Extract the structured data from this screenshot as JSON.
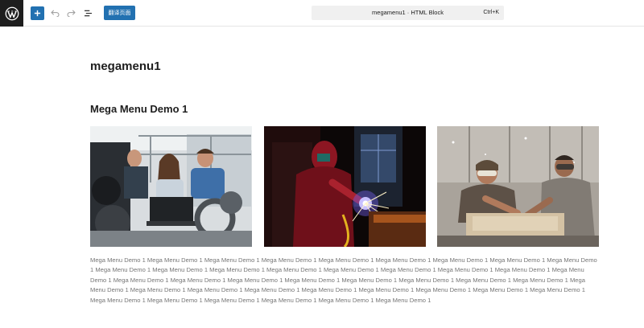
{
  "toolbar": {
    "logo_icon": "wordpress-logo-icon",
    "icons": [
      "plus-icon",
      "undo-icon",
      "redo-icon",
      "list-view-icon"
    ],
    "translate_label": "翻译页面",
    "document_title": "megamenu1 · HTML Block",
    "shortcut": "Ctrl+K",
    "accent_color": "#2271b1"
  },
  "content": {
    "page_title": "megamenu1",
    "heading": "Mega Menu Demo 1",
    "images": [
      {
        "subject": "team-working-on-robotics"
      },
      {
        "subject": "welder-with-sparks"
      },
      {
        "subject": "woodworkers-at-workbench"
      }
    ],
    "body_text": "Mega Menu Demo 1 Mega Menu Demo 1 Mega Menu Demo 1 Mega Menu Demo 1 Mega Menu Demo 1 Mega Menu Demo 1 Mega Menu Demo 1 Mega Menu Demo 1 Mega Menu Demo 1 Mega Menu Demo 1 Mega Menu Demo 1 Mega Menu Demo 1 Mega Menu Demo 1 Mega Menu Demo 1 Mega Menu Demo 1 Mega Menu Demo 1 Mega Menu Demo 1 Mega Menu Demo 1 Mega Menu Demo 1 Mega Menu Demo 1 Mega Menu Demo 1 Mega Menu Demo 1 Mega Menu Demo 1 Mega Menu Demo 1 Mega Menu Demo 1 Mega Menu Demo 1 Mega Menu Demo 1 Mega Menu Demo 1 Mega Menu Demo 1 Mega Menu Demo 1 Mega Menu Demo 1 Mega Menu Demo 1 Mega Menu Demo 1 Mega Menu Demo 1 Mega Menu Demo 1 Mega Menu Demo 1 Mega Menu Demo 1 Mega Menu Demo 1 Mega Menu Demo 1 Mega Menu Demo 1 Mega Menu Demo 1"
  }
}
